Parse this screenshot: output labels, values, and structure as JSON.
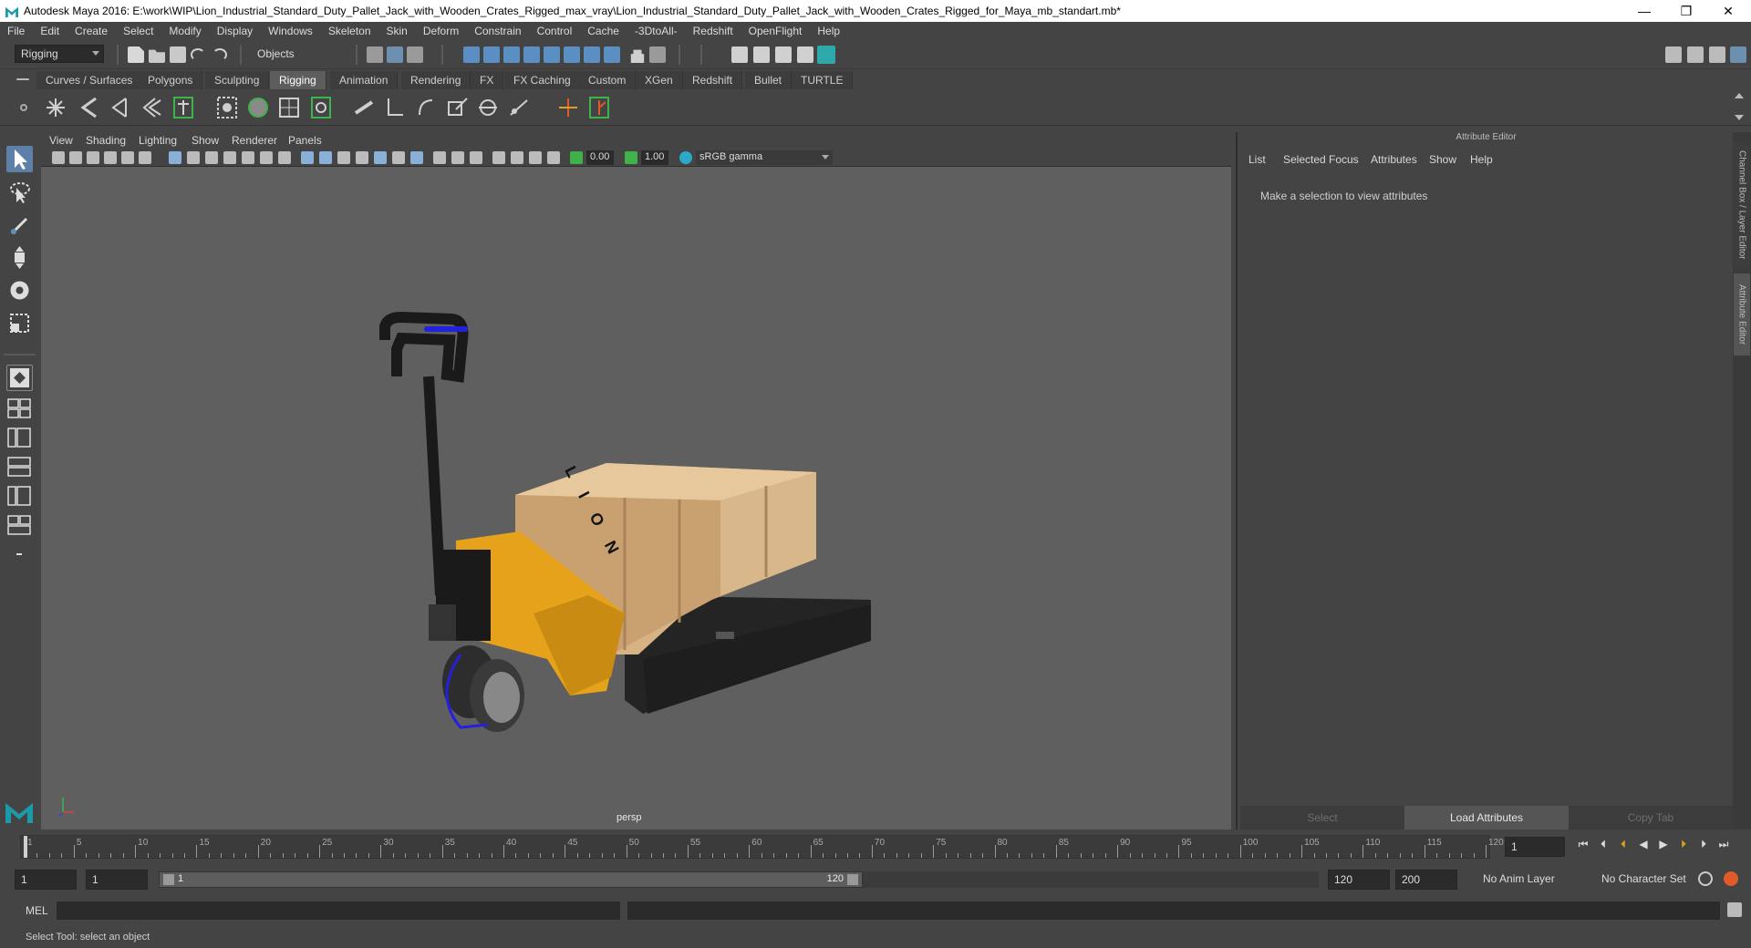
{
  "window": {
    "title": "Autodesk Maya 2016: E:\\work\\WIP\\Lion_Industrial_Standard_Duty_Pallet_Jack_with_Wooden_Crates_Rigged_max_vray\\Lion_Industrial_Standard_Duty_Pallet_Jack_with_Wooden_Crates_Rigged_for_Maya_mb_standart.mb*",
    "minimize": "—",
    "maximize": "❐",
    "close": "✕"
  },
  "menubar": [
    "File",
    "Edit",
    "Create",
    "Select",
    "Modify",
    "Display",
    "Windows",
    "Skeleton",
    "Skin",
    "Deform",
    "Constrain",
    "Control",
    "Cache",
    "-3DtoAll-",
    "Redshift",
    "OpenFlight",
    "Help"
  ],
  "statusline": {
    "menuset": "Rigging",
    "selection_mode": "Objects"
  },
  "shelf_tabs": [
    "Curves / Surfaces",
    "Polygons",
    "Sculpting",
    "Rigging",
    "Animation",
    "Rendering",
    "FX",
    "FX Caching",
    "Custom",
    "XGen",
    "Redshift",
    "Bullet",
    "TURTLE"
  ],
  "shelf_active": "Rigging",
  "panel_menu": [
    "View",
    "Shading",
    "Lighting",
    "Show",
    "Renderer",
    "Panels"
  ],
  "panel_tools": {
    "exposure": "0.00",
    "gamma": "1.00",
    "color_space": "sRGB gamma"
  },
  "viewport": {
    "camera_label": "persp",
    "brand_text": "L I O N"
  },
  "attribute_editor": {
    "header": "Attribute Editor",
    "menu": [
      "List",
      "Selected",
      "Focus",
      "Attributes",
      "Show",
      "Help"
    ],
    "message": "Make a selection to view attributes",
    "buttons": [
      "Select",
      "Load Attributes",
      "Copy Tab"
    ],
    "side_tabs": [
      "Channel Box / Layer Editor",
      "Attribute Editor"
    ]
  },
  "timeline": {
    "ticks": [
      1,
      5,
      10,
      15,
      20,
      25,
      30,
      35,
      40,
      45,
      50,
      55,
      60,
      65,
      70,
      75,
      80,
      85,
      90,
      95,
      100,
      105,
      110,
      115,
      120
    ],
    "current_frame": "1"
  },
  "range": {
    "start": "1",
    "playback_start": "1",
    "slider_start": "1",
    "slider_end": "120",
    "playback_end": "120",
    "end": "200",
    "anim_layer": "No Anim Layer",
    "character_set": "No Character Set"
  },
  "command_line": {
    "language": "MEL"
  },
  "help_line": "Select Tool: select an object",
  "colors": {
    "accent_teal": "#1d9aa8",
    "active_tab": "#5d5d5d",
    "viewport_bg": "#5f5f5f"
  }
}
